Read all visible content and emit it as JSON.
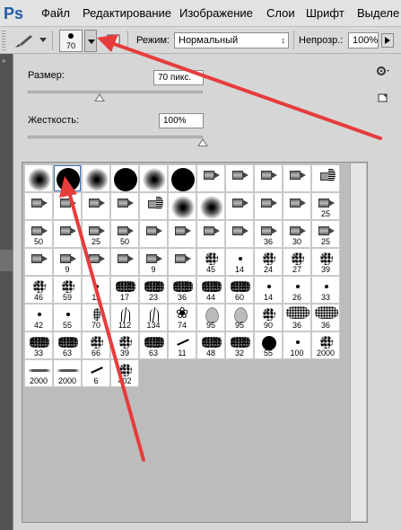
{
  "app": {
    "logo": "Ps"
  },
  "menu": [
    "Файл",
    "Редактирование",
    "Изображение",
    "Слои",
    "Шрифт",
    "Выделе"
  ],
  "options_bar": {
    "brush_size": "70",
    "mode_label": "Режим:",
    "mode_value": "Нормальный",
    "opacity_label": "Непрозр.:",
    "opacity_value": "100%"
  },
  "brush_panel": {
    "size_label": "Размер:",
    "size_value": "70 пикс.",
    "size_fraction": 0.41,
    "hardness_label": "Жесткость:",
    "hardness_value": "100%",
    "hardness_fraction": 1.0
  },
  "brushes": [
    {
      "type": "soft",
      "label": ""
    },
    {
      "type": "hard",
      "label": ""
    },
    {
      "type": "soft",
      "label": ""
    },
    {
      "type": "hard",
      "label": ""
    },
    {
      "type": "soft",
      "label": ""
    },
    {
      "type": "hard",
      "label": ""
    },
    {
      "type": "tool",
      "label": ""
    },
    {
      "type": "tool",
      "label": ""
    },
    {
      "type": "tool",
      "label": ""
    },
    {
      "type": "tool",
      "label": ""
    },
    {
      "type": "fan",
      "label": ""
    },
    {
      "type": "tool",
      "label": ""
    },
    {
      "type": "tool",
      "label": ""
    },
    {
      "type": "tool",
      "label": ""
    },
    {
      "type": "tool",
      "label": ""
    },
    {
      "type": "fan",
      "label": ""
    },
    {
      "type": "soft",
      "label": ""
    },
    {
      "type": "soft",
      "label": ""
    },
    {
      "type": "tool",
      "label": ""
    },
    {
      "type": "tool",
      "label": ""
    },
    {
      "type": "tool",
      "label": ""
    },
    {
      "type": "tool",
      "label": "25"
    },
    {
      "type": "tool",
      "label": "50"
    },
    {
      "type": "tool",
      "label": ""
    },
    {
      "type": "tool",
      "label": "25"
    },
    {
      "type": "tool",
      "label": "50"
    },
    {
      "type": "tool",
      "label": ""
    },
    {
      "type": "tool",
      "label": ""
    },
    {
      "type": "tool",
      "label": ""
    },
    {
      "type": "tool",
      "label": ""
    },
    {
      "type": "tool",
      "label": "36"
    },
    {
      "type": "tool",
      "label": "30"
    },
    {
      "type": "tool",
      "label": "25"
    },
    {
      "type": "tool",
      "label": ""
    },
    {
      "type": "tool",
      "label": "9"
    },
    {
      "type": "tool",
      "label": ""
    },
    {
      "type": "tool",
      "label": ""
    },
    {
      "type": "tool",
      "label": "9"
    },
    {
      "type": "tool",
      "label": ""
    },
    {
      "type": "spray",
      "label": "45"
    },
    {
      "type": "dot",
      "label": "14"
    },
    {
      "type": "spray",
      "label": "24"
    },
    {
      "type": "spray",
      "label": "27"
    },
    {
      "type": "spray",
      "label": "39"
    },
    {
      "type": "spray",
      "label": "46"
    },
    {
      "type": "spray",
      "label": "59"
    },
    {
      "type": "dot",
      "label": "11"
    },
    {
      "type": "blot",
      "label": "17"
    },
    {
      "type": "blot",
      "label": "23"
    },
    {
      "type": "blot",
      "label": "36"
    },
    {
      "type": "blot",
      "label": "44"
    },
    {
      "type": "blot",
      "label": "60"
    },
    {
      "type": "dot",
      "label": "14"
    },
    {
      "type": "dot",
      "label": "26"
    },
    {
      "type": "dot",
      "label": "33"
    },
    {
      "type": "dot",
      "label": "42"
    },
    {
      "type": "dot",
      "label": "55"
    },
    {
      "type": "brushsm",
      "label": "70"
    },
    {
      "type": "grass",
      "label": "112"
    },
    {
      "type": "grass",
      "label": "134"
    },
    {
      "type": "maple",
      "label": "74"
    },
    {
      "type": "leaf",
      "label": "95"
    },
    {
      "type": "leaf",
      "label": "95"
    },
    {
      "type": "spray",
      "label": "90"
    },
    {
      "type": "big",
      "label": "36"
    },
    {
      "type": "big",
      "label": "36"
    },
    {
      "type": "blot",
      "label": "33"
    },
    {
      "type": "blot",
      "label": "63"
    },
    {
      "type": "spray",
      "label": "66"
    },
    {
      "type": "spray",
      "label": "39"
    },
    {
      "type": "blot",
      "label": "63"
    },
    {
      "type": "stroke",
      "label": "11"
    },
    {
      "type": "blot",
      "label": "48"
    },
    {
      "type": "blot",
      "label": "32"
    },
    {
      "type": "hardsm",
      "label": "55"
    },
    {
      "type": "dot",
      "label": "100"
    },
    {
      "type": "spray",
      "label": "2000"
    },
    {
      "type": "line",
      "label": "2000"
    },
    {
      "type": "line",
      "label": "2000"
    },
    {
      "type": "stroke",
      "label": "6"
    },
    {
      "type": "spray",
      "label": "402"
    }
  ]
}
